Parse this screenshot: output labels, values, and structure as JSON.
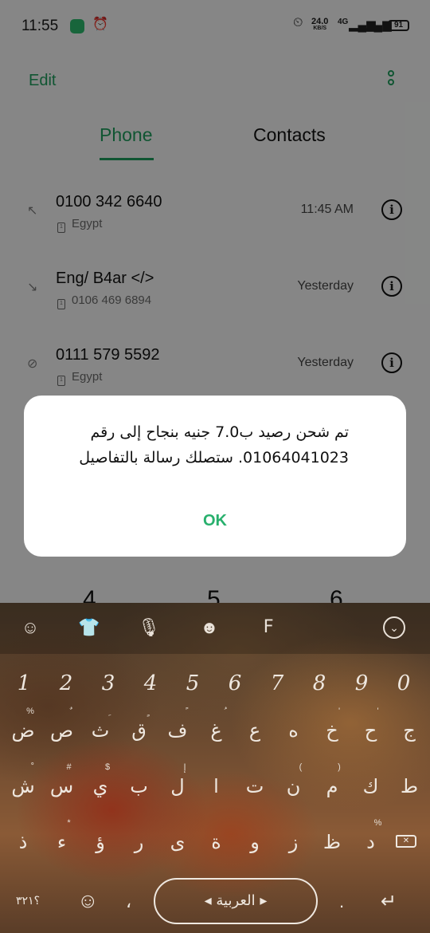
{
  "status_bar": {
    "time": "11:55",
    "net_speed_value": "24.0",
    "net_speed_unit": "KB/S",
    "network": "4G",
    "battery": "91"
  },
  "header": {
    "edit_label": "Edit",
    "more_icon": "more-vertical-icon"
  },
  "tabs": [
    {
      "label": "Phone",
      "active": true
    },
    {
      "label": "Contacts",
      "active": false
    }
  ],
  "calls": [
    {
      "number": "0100 342 6640",
      "sub": "Egypt",
      "time": "11:45 AM",
      "type_icon": "↖"
    },
    {
      "number": "Eng/ B4ar </>",
      "sub": "0106 469 6894",
      "time": "Yesterday",
      "type_icon": "↘"
    },
    {
      "number": "0111 579 5592",
      "sub": "Egypt",
      "time": "Yesterday",
      "type_icon": "⊘"
    }
  ],
  "dialpad_peek": [
    "4",
    "5",
    "6"
  ],
  "dialog": {
    "message": "تم شحن رصيد ب7.0 جنيه بنجاح إلى رقم 01064041023. ستصلك رسالة بالتفاصيل",
    "ok_label": "OK"
  },
  "keyboard": {
    "numbers": [
      "1",
      "2",
      "3",
      "4",
      "5",
      "6",
      "7",
      "8",
      "9",
      "0"
    ],
    "row1": [
      {
        "key": "ض",
        "hint": "%"
      },
      {
        "key": "ص",
        "hint": "ٌ"
      },
      {
        "key": "ث",
        "hint": "ِ"
      },
      {
        "key": "ق",
        "hint": "ٍ"
      },
      {
        "key": "ف",
        "hint": "ً"
      },
      {
        "key": "غ",
        "hint": "ُ"
      },
      {
        "key": "ع",
        "hint": ""
      },
      {
        "key": "ه",
        "hint": ""
      },
      {
        "key": "خ",
        "hint": "'"
      },
      {
        "key": "ح",
        "hint": "'"
      },
      {
        "key": "ج",
        "hint": ""
      }
    ],
    "row2": [
      {
        "key": "ش",
        "hint": "ْ"
      },
      {
        "key": "س",
        "hint": "#"
      },
      {
        "key": "ي",
        "hint": "$"
      },
      {
        "key": "ب",
        "hint": ""
      },
      {
        "key": "ل",
        "hint": "إ"
      },
      {
        "key": "ا",
        "hint": ""
      },
      {
        "key": "ت",
        "hint": ""
      },
      {
        "key": "ن",
        "hint": "("
      },
      {
        "key": "م",
        "hint": ")"
      },
      {
        "key": "ك",
        "hint": ""
      },
      {
        "key": "ط",
        "hint": ""
      }
    ],
    "row3": [
      {
        "key": "ذ",
        "hint": ""
      },
      {
        "key": "ء",
        "hint": "*"
      },
      {
        "key": "ؤ",
        "hint": ""
      },
      {
        "key": "ر",
        "hint": ""
      },
      {
        "key": "ى",
        "hint": ""
      },
      {
        "key": "ة",
        "hint": ""
      },
      {
        "key": "و",
        "hint": ""
      },
      {
        "key": "ز",
        "hint": ""
      },
      {
        "key": "ظ",
        "hint": ""
      },
      {
        "key": "د",
        "hint": "%"
      }
    ],
    "symbols_label": "؟٣٢١",
    "emoji_icon": "emoji-icon",
    "comma": "،",
    "space_label": "العربية",
    "period": ".",
    "enter_icon": "enter-icon"
  },
  "colors": {
    "accent": "#1e9c5c",
    "ok": "#28b06d"
  }
}
